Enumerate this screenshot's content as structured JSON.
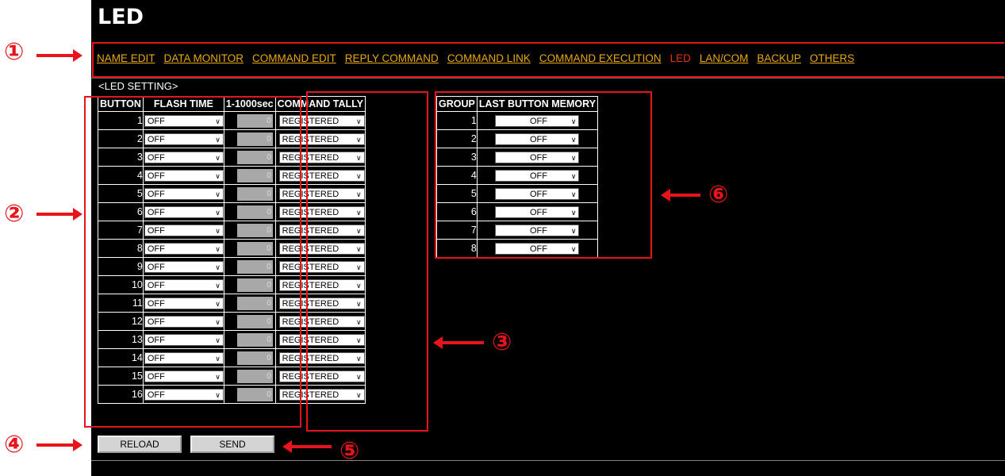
{
  "page_title": "LED",
  "nav": [
    {
      "label": "NAME EDIT",
      "current": false
    },
    {
      "label": "DATA MONITOR",
      "current": false
    },
    {
      "label": "COMMAND EDIT",
      "current": false
    },
    {
      "label": "REPLY COMMAND",
      "current": false
    },
    {
      "label": "COMMAND LINK",
      "current": false
    },
    {
      "label": "COMMAND EXECUTION",
      "current": false
    },
    {
      "label": "LED",
      "current": true
    },
    {
      "label": "LAN/COM",
      "current": false
    },
    {
      "label": "BACKUP",
      "current": false
    },
    {
      "label": "OTHERS",
      "current": false
    }
  ],
  "section_title": "<LED SETTING>",
  "led_table": {
    "headers": [
      "BUTTON",
      "FLASH TIME",
      "1-1000sec",
      "COMMAND TALLY"
    ],
    "rows": [
      {
        "button": "1",
        "flash": "OFF",
        "sec": "0",
        "tally": "REGISTERED"
      },
      {
        "button": "2",
        "flash": "OFF",
        "sec": "0",
        "tally": "REGISTERED"
      },
      {
        "button": "3",
        "flash": "OFF",
        "sec": "0",
        "tally": "REGISTERED"
      },
      {
        "button": "4",
        "flash": "OFF",
        "sec": "0",
        "tally": "REGISTERED"
      },
      {
        "button": "5",
        "flash": "OFF",
        "sec": "0",
        "tally": "REGISTERED"
      },
      {
        "button": "6",
        "flash": "OFF",
        "sec": "0",
        "tally": "REGISTERED"
      },
      {
        "button": "7",
        "flash": "OFF",
        "sec": "0",
        "tally": "REGISTERED"
      },
      {
        "button": "8",
        "flash": "OFF",
        "sec": "0",
        "tally": "REGISTERED"
      },
      {
        "button": "9",
        "flash": "OFF",
        "sec": "0",
        "tally": "REGISTERED"
      },
      {
        "button": "10",
        "flash": "OFF",
        "sec": "0",
        "tally": "REGISTERED"
      },
      {
        "button": "11",
        "flash": "OFF",
        "sec": "0",
        "tally": "REGISTERED"
      },
      {
        "button": "12",
        "flash": "OFF",
        "sec": "0",
        "tally": "REGISTERED"
      },
      {
        "button": "13",
        "flash": "OFF",
        "sec": "0",
        "tally": "REGISTERED"
      },
      {
        "button": "14",
        "flash": "OFF",
        "sec": "0",
        "tally": "REGISTERED"
      },
      {
        "button": "15",
        "flash": "OFF",
        "sec": "0",
        "tally": "REGISTERED"
      },
      {
        "button": "16",
        "flash": "OFF",
        "sec": "0",
        "tally": "REGISTERED"
      }
    ]
  },
  "group_table": {
    "headers": [
      "GROUP",
      "LAST BUTTON MEMORY"
    ],
    "rows": [
      {
        "group": "1",
        "memory": "OFF"
      },
      {
        "group": "2",
        "memory": "OFF"
      },
      {
        "group": "3",
        "memory": "OFF"
      },
      {
        "group": "4",
        "memory": "OFF"
      },
      {
        "group": "5",
        "memory": "OFF"
      },
      {
        "group": "6",
        "memory": "OFF"
      },
      {
        "group": "7",
        "memory": "OFF"
      },
      {
        "group": "8",
        "memory": "OFF"
      }
    ]
  },
  "buttons": {
    "reload": "RELOAD",
    "send": "SEND"
  },
  "callouts": [
    "①",
    "②",
    "③",
    "④",
    "⑤",
    "⑥"
  ],
  "icons": {
    "dropdown": "chevron-down-icon",
    "callout_arrow": "red-arrow-icon"
  },
  "colors": {
    "background": "#000000",
    "link": "#e8a812",
    "current_link": "#e03010",
    "annotation": "#e8141b"
  }
}
